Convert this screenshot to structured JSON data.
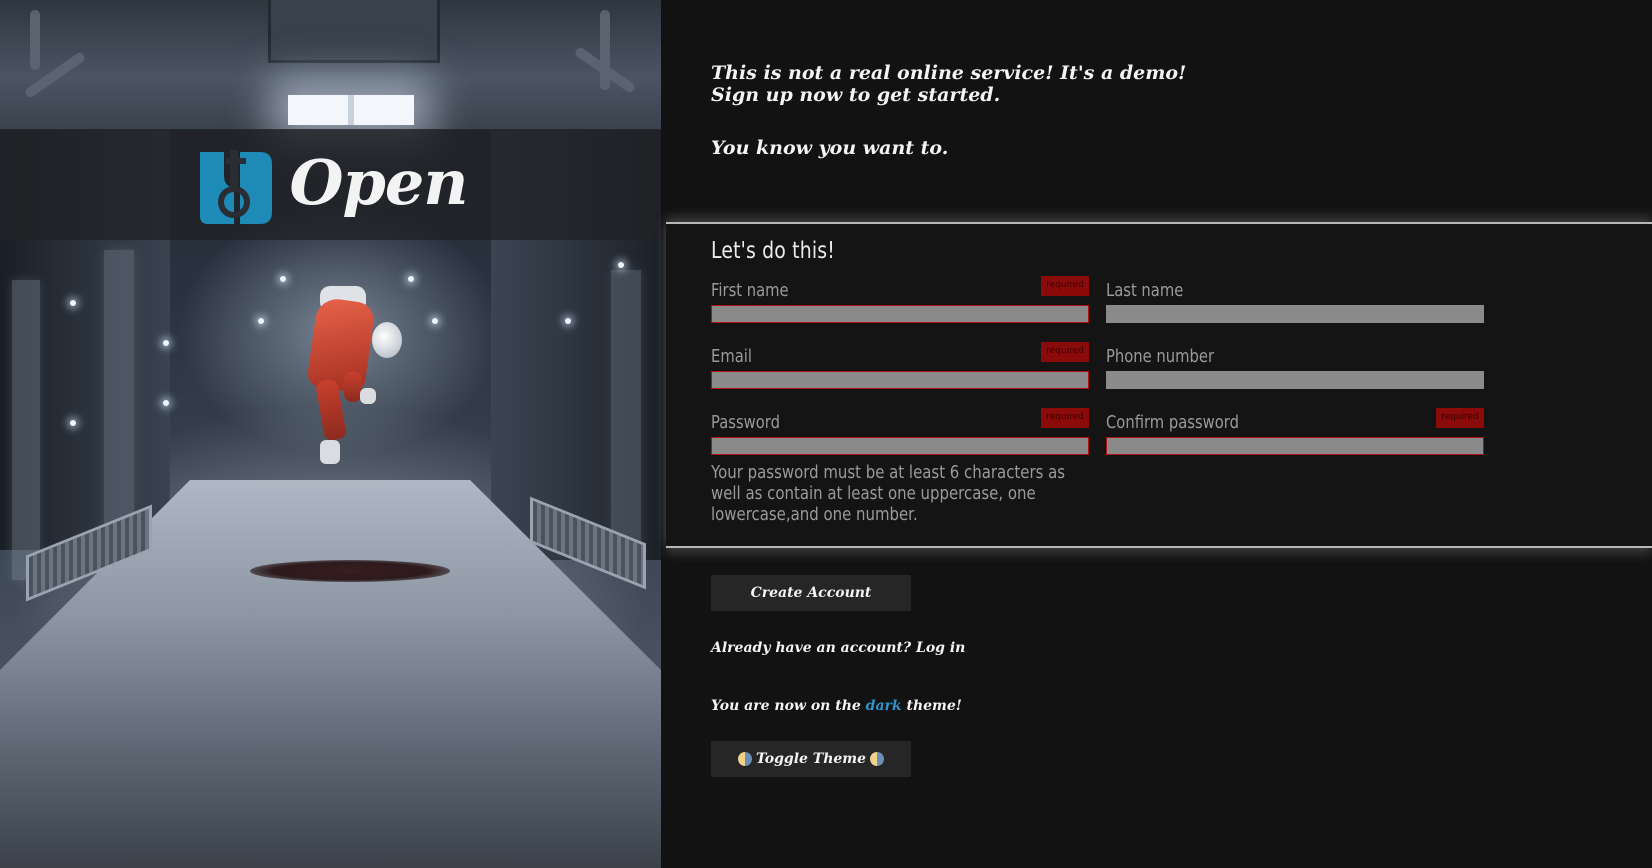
{
  "brand": {
    "name": "Open",
    "logo_color": "#1d8ab8"
  },
  "intro": {
    "line1": "This is not a real online service! It's a demo!",
    "line2": "Sign up now to get started.",
    "line3": "You know you want to."
  },
  "form": {
    "title": "Let's do this!",
    "required_badge": "required",
    "fields": {
      "first_name": {
        "label": "First name",
        "value": "",
        "required": true
      },
      "last_name": {
        "label": "Last name",
        "value": "",
        "required": false
      },
      "email": {
        "label": "Email",
        "value": "",
        "required": true
      },
      "phone": {
        "label": "Phone number",
        "value": "",
        "required": false
      },
      "password": {
        "label": "Password",
        "value": "",
        "required": true
      },
      "confirm_password": {
        "label": "Confirm password",
        "value": "",
        "required": true
      }
    },
    "password_hint": "Your password must be at least 6 characters as well as contain at least one uppercase, one lowercase,and one number."
  },
  "actions": {
    "create_account": "Create Account",
    "login_prompt": "Already have an account? Log in",
    "theme_prefix": "You are now on the",
    "theme_name": "dark",
    "theme_suffix": "theme!",
    "toggle_theme": "Toggle Theme"
  },
  "colors": {
    "background": "#121212",
    "required_badge": "#8b0a0a",
    "accent": "#2f93c8",
    "input": "#8a8a8a"
  }
}
